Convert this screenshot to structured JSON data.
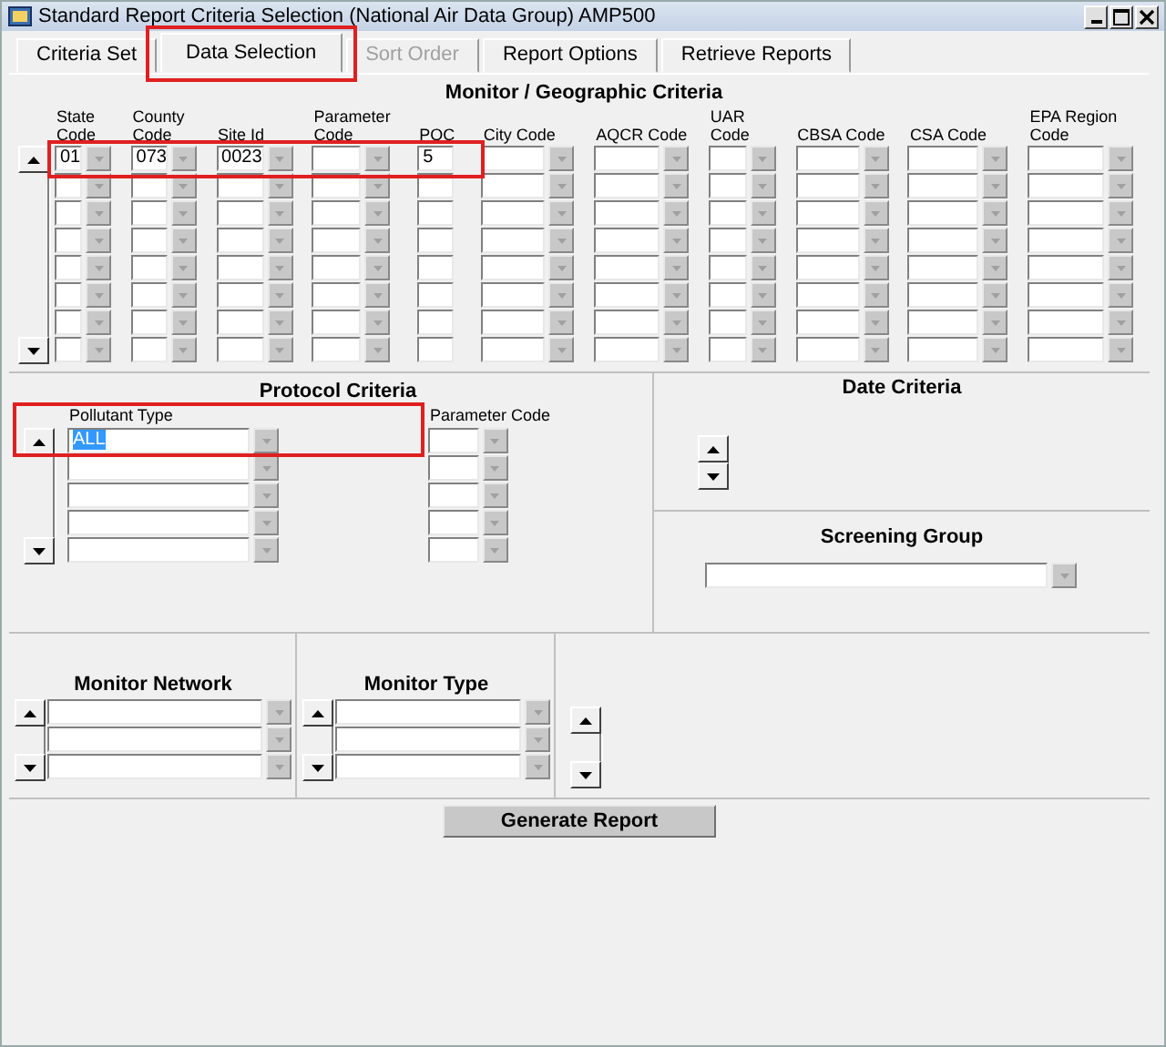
{
  "window": {
    "title": "Standard Report Criteria Selection (National Air Data Group) AMP500"
  },
  "tabs": [
    {
      "label": "Criteria Set",
      "selected": false,
      "disabled": false,
      "highlighted": false
    },
    {
      "label": "Data Selection",
      "selected": true,
      "disabled": false,
      "highlighted": true
    },
    {
      "label": "Sort Order",
      "selected": false,
      "disabled": true,
      "highlighted": false
    },
    {
      "label": "Report Options",
      "selected": false,
      "disabled": false,
      "highlighted": false
    },
    {
      "label": "Retrieve Reports",
      "selected": false,
      "disabled": false,
      "highlighted": false
    }
  ],
  "monitor_geographic": {
    "title": "Monitor / Geographic Criteria",
    "first_row_highlighted": true,
    "columns": [
      {
        "header": "State Code",
        "value": "01",
        "dropdown": true
      },
      {
        "header": "County Code",
        "value": "073",
        "dropdown": true
      },
      {
        "header": "Site Id",
        "value": "0023",
        "dropdown": true
      },
      {
        "header": "Parameter Code",
        "dropdown": true
      },
      {
        "header": "POC",
        "value": "5",
        "dropdown": false
      },
      {
        "header": "City Code",
        "dropdown": true
      },
      {
        "header": "AQCR Code",
        "dropdown": true
      },
      {
        "header": "UAR Code",
        "dropdown": true
      },
      {
        "header": "CBSA Code",
        "dropdown": true
      },
      {
        "header": "CSA Code",
        "dropdown": true
      },
      {
        "header": "EPA Region Code",
        "dropdown": true
      }
    ]
  },
  "protocol_criteria": {
    "title": "Protocol Criteria",
    "first_row_highlighted": true,
    "columns": [
      {
        "header": "Pollutant Type",
        "value": "ALL",
        "text_selected": true
      },
      {
        "header": "Parameter Code"
      }
    ]
  },
  "date_criteria": {
    "title": "Date Criteria"
  },
  "screening_group": {
    "title": "Screening Group"
  },
  "monitor_network": {
    "title": "Monitor Network"
  },
  "monitor_type": {
    "title": "Monitor Type"
  },
  "generate_button": {
    "label": "Generate Report"
  }
}
